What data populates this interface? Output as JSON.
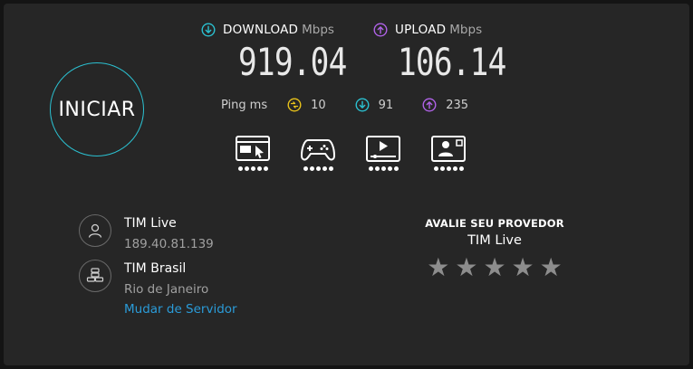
{
  "start_button": {
    "label": "INICIAR"
  },
  "download": {
    "label": "DOWNLOAD",
    "unit": "Mbps",
    "value": "919.04",
    "icon": "download-arrow-icon",
    "color": "#2bc0d0"
  },
  "upload": {
    "label": "UPLOAD",
    "unit": "Mbps",
    "value": "106.14",
    "icon": "upload-arrow-icon",
    "color": "#b063e8"
  },
  "ping": {
    "label": "Ping",
    "unit": "ms",
    "idle": {
      "value": "10",
      "icon": "jitter-icon",
      "color": "#e8c21a"
    },
    "download": {
      "value": "91",
      "icon": "download-arrow-icon",
      "color": "#2bc0d0"
    },
    "upload": {
      "value": "235",
      "icon": "upload-arrow-icon",
      "color": "#b063e8"
    }
  },
  "test_icons": [
    {
      "icon": "web-browsing-icon",
      "rating": 5
    },
    {
      "icon": "gaming-controller-icon",
      "rating": 5
    },
    {
      "icon": "video-streaming-icon",
      "rating": 5
    },
    {
      "icon": "video-call-icon",
      "rating": 5
    }
  ],
  "client": {
    "isp": "TIM Live",
    "ip": "189.40.81.139",
    "icon": "person-icon"
  },
  "server": {
    "name": "TIM Brasil",
    "location": "Rio de Janeiro",
    "change_link": "Mudar de Servidor",
    "icon": "server-icon"
  },
  "rating": {
    "title": "AVALIE SEU PROVEDOR",
    "provider": "TIM Live",
    "stars": 5,
    "selected": 0
  }
}
